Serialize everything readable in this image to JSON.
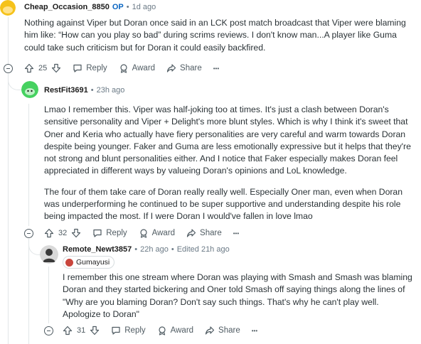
{
  "comments": [
    {
      "username": "Cheap_Occasion_8850",
      "op_badge": "OP",
      "separator": "•",
      "time": "1d ago",
      "body": [
        "Nothing against Viper but Doran once said in an LCK post match broadcast that Viper were blaming him like: “How can you play so bad” during scrims reviews. I don't know man...A player like Guma could take such criticism but for Doran it could easily backfired."
      ],
      "votes": "25",
      "reply_label": "Reply",
      "award_label": "Award",
      "share_label": "Share",
      "more_label": "•••",
      "avatar_color": "#f5c21b"
    },
    {
      "username": "RestFit3691",
      "separator": "•",
      "time": "23h ago",
      "body": [
        "Lmao I remember this. Viper was half-joking too at times. It's just a clash between Doran's sensitive personality and Viper + Delight's more blunt styles. Which is why I think it's sweet that Oner and Keria who actually have fiery personalities are very careful and warm towards Doran despite being younger. Faker and Guma are less emotionally expressive but it helps that they're not strong and blunt personalities either. And I notice that Faker especially makes Doran feel appreciated in different ways by valueing Doran's opinions and LoL knowledge.",
        "The four of them take care of Doran really really well. Especially Oner man, even when Doran was underperforming he continued to be super supportive and understanding despite his role being impacted the most. If I were Doran I would've fallen in love lmao"
      ],
      "votes": "32",
      "reply_label": "Reply",
      "award_label": "Award",
      "share_label": "Share",
      "more_label": "•••",
      "avatar_color": "#46d160"
    },
    {
      "username": "Remote_Newt3857",
      "separator": "•",
      "time": "22h ago",
      "edited": "Edited 21h ago",
      "flair": "Gumayusi",
      "body": [
        "I remember this one stream where Doran was playing with Smash and Smash was blaming Doran and they started bickering and Oner told Smash off saying things along the lines of \"Why are you blaming Doran? Don't say such things. That's why he can't play well. Apologize to Doran\""
      ],
      "votes": "31",
      "reply_label": "Reply",
      "award_label": "Award",
      "share_label": "Share",
      "more_label": "•••",
      "avatar_color": "#3a3a3a"
    }
  ]
}
